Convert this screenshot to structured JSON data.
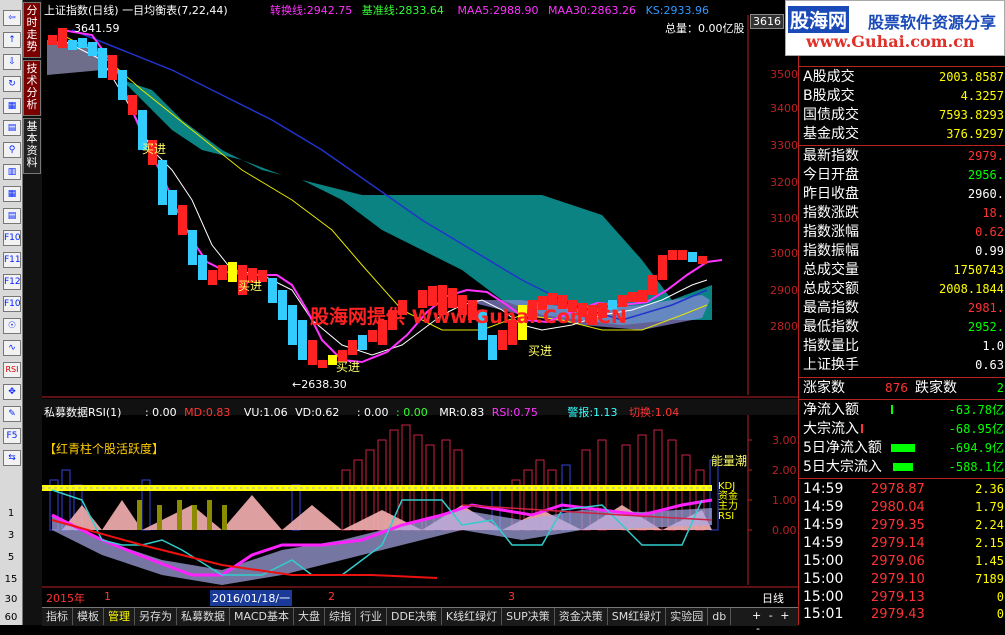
{
  "toolbar": {
    "icons": [
      "⇦",
      "↑",
      "⇩",
      "↻",
      "▦",
      "▤",
      "⚲",
      "▥",
      "▦",
      "▤",
      "F10",
      "F11",
      "F12",
      "F10",
      "☉",
      "∿",
      "RSI",
      "✥",
      "✎",
      "F5",
      "⇆"
    ],
    "numbers": [
      "1",
      "3",
      "5",
      "15",
      "30",
      "60"
    ]
  },
  "vtabs": [
    "分时走势",
    "技术分析",
    "基本资料"
  ],
  "main_header": {
    "title": "上证指数(日线) 一目均衡表(7,22,44)",
    "zh_label": "转换线:",
    "zh_val": "2942.75",
    "jz_label": "基准线:",
    "jz_val": "2833.64",
    "maa5_label": "MAA5:",
    "maa5_val": "2988.90",
    "maa30_label": "MAA30:",
    "maa30_val": "2863.26",
    "ks_label": "KS:",
    "ks_val": "2933.96",
    "total": "总量：0.00亿股",
    "price_top": "3616"
  },
  "price_axis": [
    "3500",
    "3400",
    "3300",
    "3200",
    "3100",
    "3000",
    "2900",
    "2800"
  ],
  "chart_labels": {
    "high": "3641.59",
    "low": "←2638.30",
    "buy": "买进",
    "watermark": "股海网提供 Www.Guhai.Com.CN"
  },
  "sub_header": {
    "name": "私募数据RSI(1)",
    "v0": ": 0.00",
    "md_label": "MD:",
    "md_val": "0.83",
    "vu_label": "VU:",
    "vu_val": "1.06",
    "vd_label": "VD:",
    "vd_val": "0.62",
    "z1": ": 0.00",
    "z2": ": 0.00",
    "mr_label": "MR:",
    "mr_val": "0.83",
    "rsi_label": "RSI:",
    "rsi_val": "0.75",
    "bj_label": "警报:",
    "bj_val": "1.13",
    "qh_label": "切换:",
    "qh_val": "1.04"
  },
  "sub_chart": {
    "legend": "【红青柱个股活跃度】",
    "nlc": "能量潮",
    "kdj": "KDJ",
    "dqb": "资金",
    "zhuli": "主力",
    "rsi": "RSI",
    "axis": [
      "3.00",
      "2.00",
      "1.00",
      "0.00"
    ]
  },
  "time_axis": {
    "year": "2015年",
    "m1": "1",
    "date": "2016/01/18/一",
    "m2": "2",
    "m3": "3",
    "period": "日线"
  },
  "bottom_tabs": [
    "指标",
    "模板",
    "管理",
    "另存为",
    "私募数据",
    "MACD基本",
    "大盘",
    "综指",
    "行业",
    "DDE决策",
    "K线红绿灯",
    "SUP决策",
    "资金决策",
    "SM红绿灯",
    "实验园",
    "db"
  ],
  "bottom_tab_active": "管理",
  "bottom_controls": [
    "+",
    "-",
    "+",
    "-"
  ],
  "logo": {
    "name": "股海网",
    "slogan": "股票软件资源分享",
    "url": "www.Guhai.com.cn"
  },
  "index_info": [
    {
      "label": "A股成交",
      "value": "2003.8587",
      "color": "#ffff00"
    },
    {
      "label": "B股成交",
      "value": "4.3257",
      "color": "#ffff00"
    },
    {
      "label": "国债成交",
      "value": "7593.8293",
      "color": "#ffff00"
    },
    {
      "label": "基金成交",
      "value": "376.9297",
      "color": "#ffff00"
    },
    {
      "label": "最新指数",
      "value": "2979.",
      "color": "#ff3333"
    },
    {
      "label": "今日开盘",
      "value": "2956.",
      "color": "#00ff00"
    },
    {
      "label": "昨日收盘",
      "value": "2960.",
      "color": "#ffffff"
    },
    {
      "label": "指数涨跌",
      "value": "18.",
      "color": "#ff3333"
    },
    {
      "label": "指数涨幅",
      "value": "0.62",
      "color": "#ff3333"
    },
    {
      "label": "指数振幅",
      "value": "0.99",
      "color": "#ffffff"
    },
    {
      "label": "总成交量",
      "value": "1750743",
      "color": "#ffff00"
    },
    {
      "label": "总成交额",
      "value": "2008.1844",
      "color": "#ffff00"
    },
    {
      "label": "最高指数",
      "value": "2981.",
      "color": "#ff3333"
    },
    {
      "label": "最低指数",
      "value": "2952.",
      "color": "#00ff00"
    },
    {
      "label": "指数量比",
      "value": "1.0",
      "color": "#ffffff"
    },
    {
      "label": "上证换手",
      "value": "0.63",
      "color": "#ffffff"
    }
  ],
  "updown": {
    "up_label": "涨家数",
    "up_val": "876",
    "down_label": "跌家数",
    "down_val": "2"
  },
  "flows": [
    {
      "label": "净流入额",
      "value": "-63.78亿"
    },
    {
      "label": "大宗流入",
      "value": "-68.95亿"
    },
    {
      "label": "5日净流入额",
      "value": "-694.9亿"
    },
    {
      "label": "5日大宗流入",
      "value": "-588.1亿"
    }
  ],
  "ticks": [
    {
      "time": "14:59",
      "price": "2978.87",
      "vol": "2.36",
      "pc": "#ff3333"
    },
    {
      "time": "14:59",
      "price": "2980.04",
      "vol": "1.79",
      "pc": "#ff3333"
    },
    {
      "time": "14:59",
      "price": "2979.35",
      "vol": "2.24",
      "pc": "#ff3333"
    },
    {
      "time": "14:59",
      "price": "2979.14",
      "vol": "2.15",
      "pc": "#ff3333"
    },
    {
      "time": "15:00",
      "price": "2979.06",
      "vol": "1.45",
      "pc": "#ff3333"
    },
    {
      "time": "15:00",
      "price": "2979.10",
      "vol": "7189",
      "pc": "#ff3333"
    },
    {
      "time": "15:00",
      "price": "2979.13",
      "vol": "0",
      "pc": "#ff3333"
    },
    {
      "time": "15:01",
      "price": "2979.43",
      "vol": "0",
      "pc": "#ff3333"
    }
  ]
}
